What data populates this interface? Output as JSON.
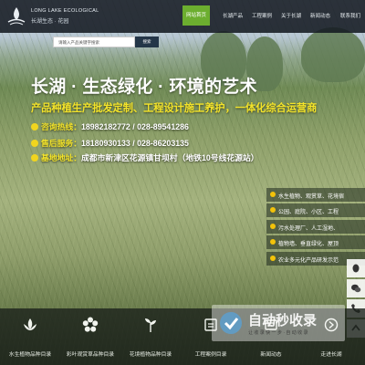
{
  "header": {
    "logo_en": "LONG LAKE ECOLOGICAL",
    "logo_cn": "长湖生态 · 花园",
    "nav": [
      {
        "label": "网站首页",
        "active": true
      },
      {
        "label": "长湖产品",
        "active": false
      },
      {
        "label": "工程案例",
        "active": false
      },
      {
        "label": "关于长湖",
        "active": false
      },
      {
        "label": "新闻动态",
        "active": false
      },
      {
        "label": "联系我们",
        "active": false
      }
    ],
    "accent_color": "#6cae2f"
  },
  "search": {
    "placeholder": "请输入产品关键字搜索",
    "button_label": "搜索"
  },
  "hero": {
    "title": "长湖 · 生态绿化 · 环境的艺术",
    "subtitle": "产品种植生产批发定制、工程设计施工养护，一体化综合运营商",
    "rows": [
      {
        "label": "咨询热线：",
        "value": "18982182772 / 028-89541286",
        "icon": "phone-icon"
      },
      {
        "label": "售后服务：",
        "value": "18180930133 / 028-86203135",
        "icon": "headset-icon"
      },
      {
        "label": "基地地址：",
        "value": "成都市新津区花源镇甘坝村（地铁10号线花源站）",
        "icon": "location-icon"
      }
    ]
  },
  "side_list": [
    "水生植物、观赏草、花境宿",
    "公园、庭院、小区、工程",
    "污水处理厂、人工湿地、",
    "植物墙、垂直绿化、屋顶",
    "农业多元化产品研发示范"
  ],
  "tools": [
    "qq-icon",
    "wechat-icon",
    "phone-icon",
    "top-icon"
  ],
  "bottom_nav": [
    {
      "label": "水生植物品种目录",
      "icon": "lotus-icon"
    },
    {
      "label": "彩叶观赏草品种目录",
      "icon": "flower-icon"
    },
    {
      "label": "花境植物品种目录",
      "icon": "garden-icon"
    },
    {
      "label": "工程案例目录",
      "icon": "case-icon"
    },
    {
      "label": "新闻动态",
      "icon": "news-icon"
    },
    {
      "label": "走进长湖",
      "icon": "enter-icon"
    }
  ],
  "watermark": {
    "title": "自动秒收录",
    "tagline": "让 收 录 快 一 步  ·  自 动 收 录"
  }
}
